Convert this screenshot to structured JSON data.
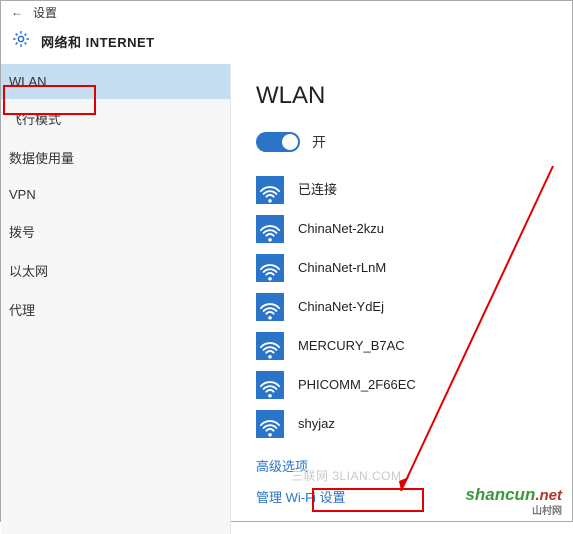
{
  "header": {
    "back_label": "←",
    "window_label": "设置"
  },
  "title": "网络和 INTERNET",
  "sidebar": {
    "items": [
      {
        "label": "WLAN",
        "selected": true
      },
      {
        "label": "飞行模式",
        "selected": false
      },
      {
        "label": "数据使用量",
        "selected": false
      },
      {
        "label": "VPN",
        "selected": false
      },
      {
        "label": "拨号",
        "selected": false
      },
      {
        "label": "以太网",
        "selected": false
      },
      {
        "label": "代理",
        "selected": false
      }
    ]
  },
  "main": {
    "page_title": "WLAN",
    "toggle": {
      "on": true,
      "label": "开"
    },
    "networks": [
      {
        "name": "",
        "status": "已连接",
        "current": true
      },
      {
        "name": "ChinaNet-2kzu",
        "status": ""
      },
      {
        "name": "ChinaNet-rLnM",
        "status": ""
      },
      {
        "name": "ChinaNet-YdEj",
        "status": ""
      },
      {
        "name": "MERCURY_B7AC",
        "status": ""
      },
      {
        "name": "PHICOMM_2F66EC",
        "status": ""
      },
      {
        "name": "shyjaz",
        "status": ""
      }
    ],
    "links": {
      "advanced": "高级选项",
      "manage": "管理 Wi-Fi 设置"
    }
  },
  "watermark": {
    "small": "三联网  3LIAN.COM",
    "brand": "shancun",
    "tld": ".net",
    "chn": "山村网"
  }
}
